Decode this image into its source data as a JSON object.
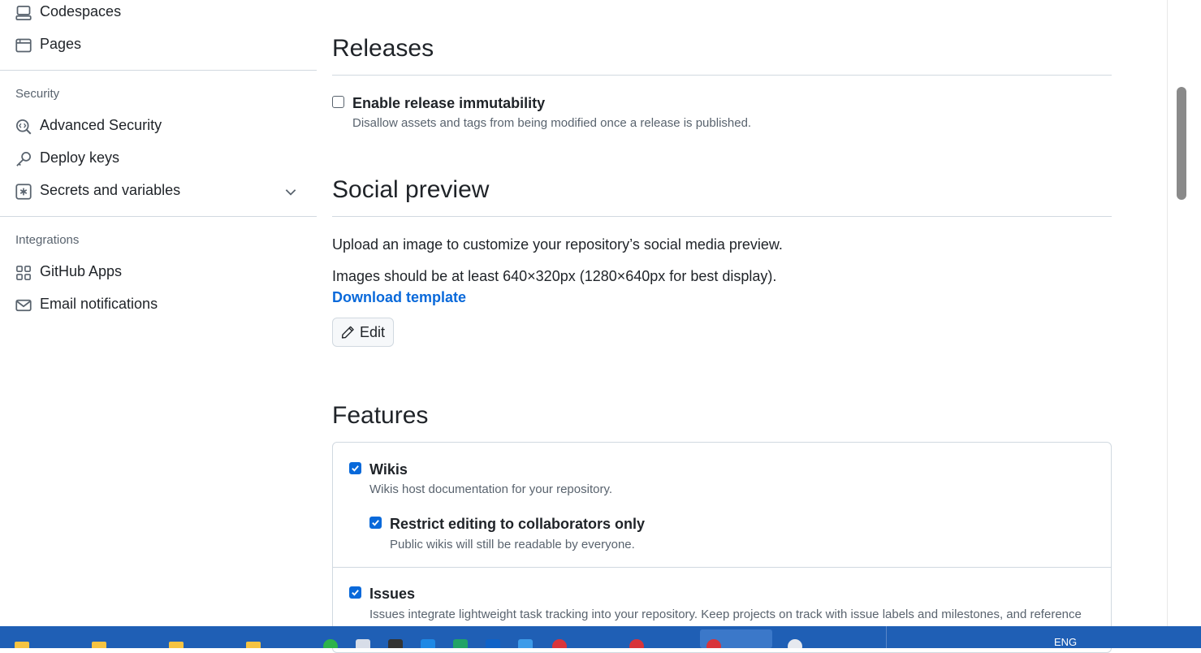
{
  "sidebar": {
    "items_top": [
      {
        "label": "Codespaces",
        "icon": "codespaces-icon"
      },
      {
        "label": "Pages",
        "icon": "browser-icon"
      }
    ],
    "security": {
      "heading": "Security",
      "items": [
        {
          "label": "Advanced Security",
          "icon": "codescan-icon"
        },
        {
          "label": "Deploy keys",
          "icon": "key-icon"
        },
        {
          "label": "Secrets and variables",
          "icon": "asterisk-icon"
        }
      ]
    },
    "integrations": {
      "heading": "Integrations",
      "items": [
        {
          "label": "GitHub Apps",
          "icon": "apps-icon"
        },
        {
          "label": "Email notifications",
          "icon": "mail-icon"
        }
      ]
    }
  },
  "releases": {
    "title": "Releases",
    "immutability": {
      "label": "Enable release immutability",
      "description": "Disallow assets and tags from being modified once a release is published.",
      "checked": false
    }
  },
  "social_preview": {
    "title": "Social preview",
    "intro": "Upload an image to customize your repository’s social media preview.",
    "size_hint": "Images should be at least 640×320px (1280×640px for best display).",
    "download_link": "Download template",
    "edit_button": "Edit"
  },
  "features": {
    "title": "Features",
    "wikis": {
      "label": "Wikis",
      "description": "Wikis host documentation for your repository.",
      "checked": true,
      "restrict": {
        "label": "Restrict editing to collaborators only",
        "description": "Public wikis will still be readable by everyone.",
        "checked": true
      }
    },
    "issues": {
      "label": "Issues",
      "description": "Issues integrate lightweight task tracking into your repository. Keep projects on track with issue labels and milestones, and reference",
      "checked": true
    }
  },
  "taskbar": {
    "language": "ENG",
    "colors": {
      "background": "#1f5fb5",
      "accent": "#0969da"
    }
  }
}
